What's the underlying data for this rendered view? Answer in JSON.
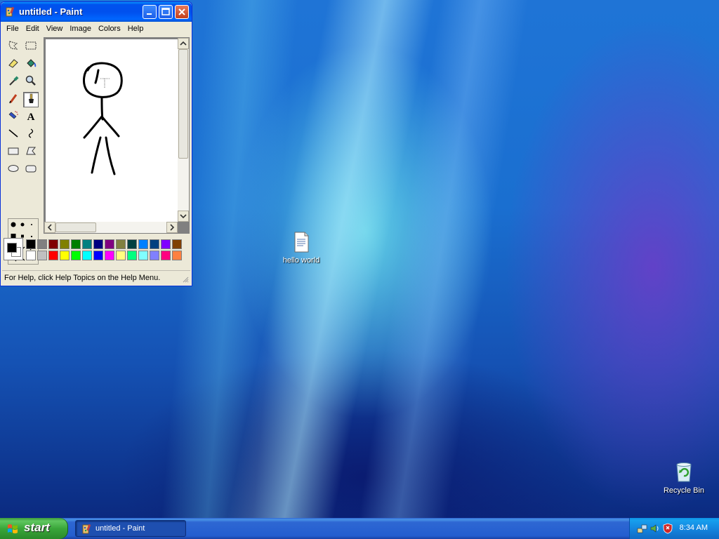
{
  "window": {
    "title": "untitled - Paint",
    "menus": [
      "File",
      "Edit",
      "View",
      "Image",
      "Colors",
      "Help"
    ],
    "status": "For Help, click Help Topics on the Help Menu."
  },
  "tools": [
    {
      "name": "free-form-select",
      "icon": "free-select-icon"
    },
    {
      "name": "select",
      "icon": "rect-select-icon"
    },
    {
      "name": "eraser",
      "icon": "eraser-icon"
    },
    {
      "name": "fill",
      "icon": "fill-bucket-icon"
    },
    {
      "name": "pick-color",
      "icon": "eyedropper-icon"
    },
    {
      "name": "magnifier",
      "icon": "magnifier-icon"
    },
    {
      "name": "pencil",
      "icon": "pencil-icon"
    },
    {
      "name": "brush",
      "icon": "brush-icon",
      "active": true
    },
    {
      "name": "airbrush",
      "icon": "airbrush-icon"
    },
    {
      "name": "text",
      "icon": "text-icon",
      "glyph": "A"
    },
    {
      "name": "line",
      "icon": "line-icon"
    },
    {
      "name": "curve",
      "icon": "curve-icon"
    },
    {
      "name": "rectangle",
      "icon": "rectangle-icon"
    },
    {
      "name": "polygon",
      "icon": "polygon-icon"
    },
    {
      "name": "ellipse",
      "icon": "ellipse-icon"
    },
    {
      "name": "rounded-rectangle",
      "icon": "rounded-rect-icon"
    }
  ],
  "palette": {
    "foreground": "#000000",
    "background": "#ffffff",
    "top_row": [
      "#000000",
      "#808080",
      "#800000",
      "#808000",
      "#008000",
      "#008080",
      "#000080",
      "#800080",
      "#808040",
      "#004040",
      "#0080ff",
      "#004080",
      "#8000ff",
      "#804000"
    ],
    "bottom_row": [
      "#ffffff",
      "#c0c0c0",
      "#ff0000",
      "#ffff00",
      "#00ff00",
      "#00ffff",
      "#0000ff",
      "#ff00ff",
      "#ffff80",
      "#00ff80",
      "#80ffff",
      "#8080ff",
      "#ff0080",
      "#ff8040"
    ]
  },
  "desktop": {
    "icons": [
      {
        "label": "hello world",
        "icon": "text-document-icon"
      },
      {
        "label": "Recycle Bin",
        "icon": "recycle-bin-icon"
      }
    ]
  },
  "taskbar": {
    "start_label": "start",
    "tasks": [
      {
        "label": "untitled - Paint",
        "icon": "paint-icon"
      }
    ],
    "clock": "8:34 AM",
    "tray_icons": [
      "network-icon",
      "volume-icon",
      "security-shield-icon"
    ]
  }
}
